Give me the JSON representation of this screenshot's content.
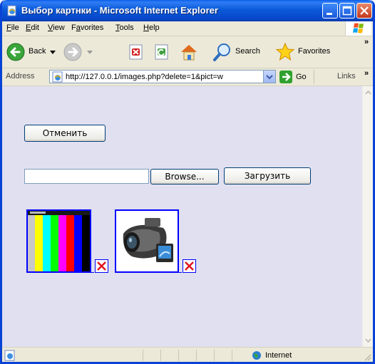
{
  "window": {
    "title": "Выбор картнки - Microsoft Internet Explorer"
  },
  "menu": [
    {
      "label": "File",
      "underline": "F",
      "rest": "ile"
    },
    {
      "label": "Edit",
      "underline": "E",
      "rest": "dit"
    },
    {
      "label": "View",
      "underline": "V",
      "rest": "iew"
    },
    {
      "label": "Favorites",
      "underline": "a",
      "pre": "F",
      "rest": "vorites"
    },
    {
      "label": "Tools",
      "underline": "T",
      "rest": "ools"
    },
    {
      "label": "Help",
      "underline": "H",
      "rest": "elp"
    }
  ],
  "toolbar": {
    "back_label": "Back",
    "search_label": "Search",
    "favorites_label": "Favorites"
  },
  "address": {
    "label": "Address",
    "url": "http://127.0.0.1/images.php?delete=1&pict=w",
    "go_label": "Go",
    "links_label": "Links"
  },
  "page": {
    "cancel_label": "Отменить",
    "browse_label": "Browse...",
    "upload_label": "Загрузить",
    "file_value": "",
    "images": [
      {
        "name": "color-bars-thumbnail",
        "icon": "color-bars"
      },
      {
        "name": "camcorder-thumbnail",
        "icon": "camcorder"
      }
    ]
  },
  "status": {
    "zone_label": "Internet"
  },
  "colors": {
    "content_bg": "#e0e0f0",
    "link": "#0000ff",
    "titlebar": "#0746c9",
    "delete_x": "#e2161d"
  }
}
